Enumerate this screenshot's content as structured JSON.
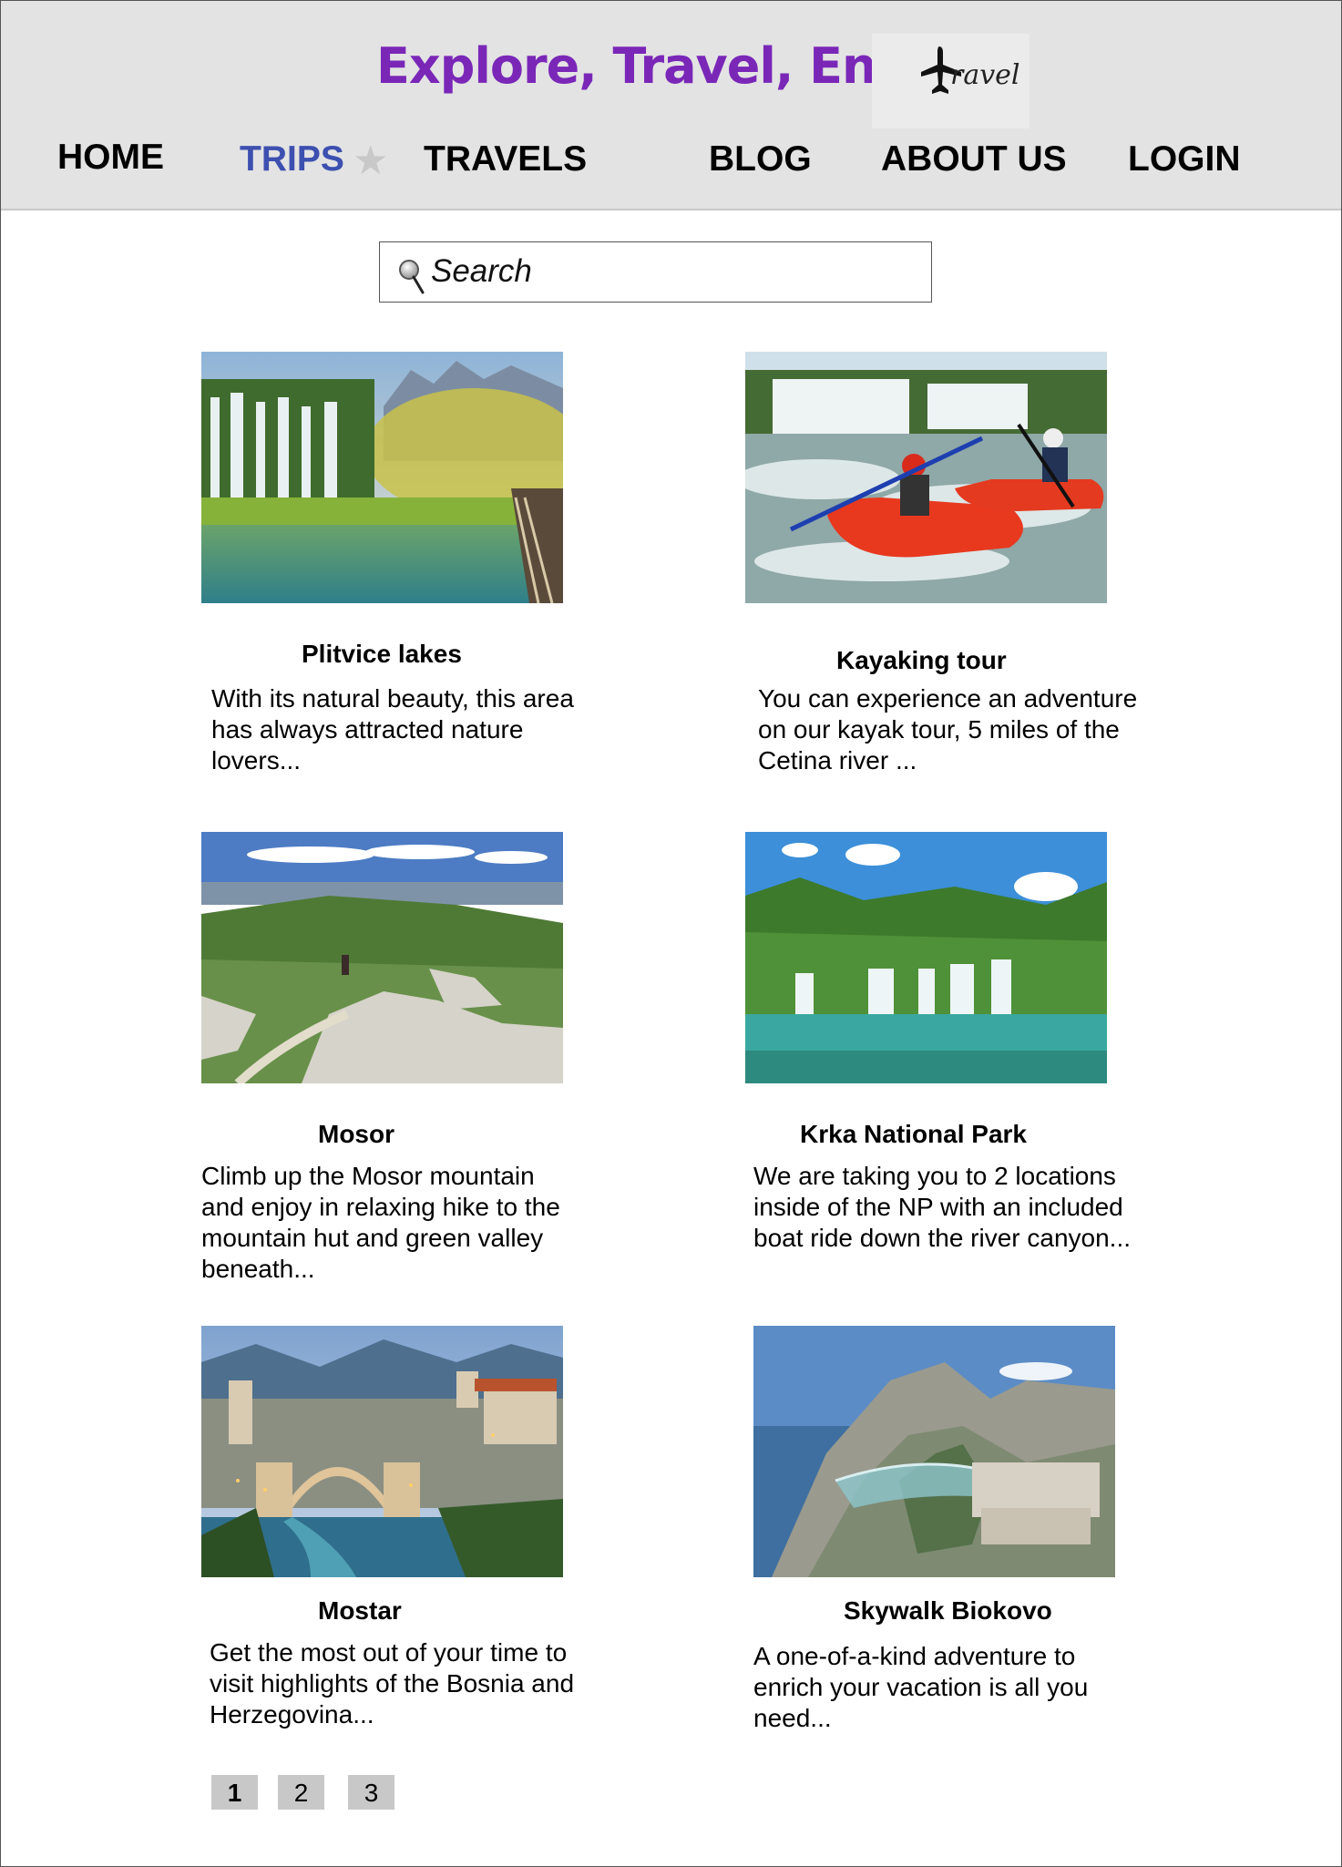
{
  "header": {
    "title": "Explore, Travel, Enjoy",
    "logo_text": "ravel"
  },
  "nav": {
    "home": "HOME",
    "trips": "TRIPS",
    "travels": "TRAVELS",
    "blog": "BLOG",
    "about": "ABOUT US",
    "login": "LOGIN"
  },
  "search": {
    "placeholder": "Search"
  },
  "cards": [
    {
      "title": "Plitvice lakes",
      "description": "With its natural beauty, this area has always attracted nature lovers...",
      "image": "waterfalls-lakes-photo"
    },
    {
      "title": "Kayaking tour",
      "description": "You can experience an adventure on our kayak tour, 5 miles of the Cetina river ...",
      "image": "kayaking-photo"
    },
    {
      "title": "Mosor",
      "description": "Climb up the Mosor mountain and enjoy in relaxing hike to the mountain hut and green valley beneath...",
      "image": "mountain-trail-photo"
    },
    {
      "title": "Krka National Park",
      "description": "We are taking you to 2 locations inside of the NP with an included boat ride down the river canyon...",
      "image": "krka-waterfalls-photo"
    },
    {
      "title": "Mostar",
      "description": "Get the most out of your time to visit highlights of the Bosnia and Herzegovina...",
      "image": "mostar-bridge-photo"
    },
    {
      "title": "Skywalk Biokovo",
      "description": "A one-of-a-kind adventure to enrich your vacation is all you need...",
      "image": "skywalk-photo"
    }
  ],
  "pagination": {
    "pages": [
      "1",
      "2",
      "3"
    ],
    "current": "1"
  },
  "colors": {
    "title": "#7a27b8",
    "active_nav": "#3d50b0",
    "header_bg": "#e3e3e3",
    "page_btn": "#c8c8c8"
  }
}
